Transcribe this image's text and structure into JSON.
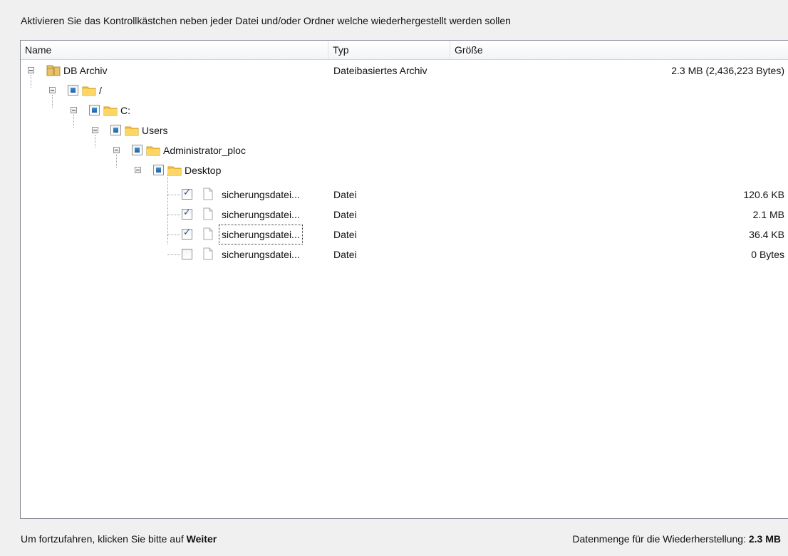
{
  "instruction": "Aktivieren Sie das Kontrollkästchen neben jeder Datei und/oder Ordner welche wiederhergestellt werden sollen",
  "columns": {
    "name": "Name",
    "type": "Typ",
    "size": "Größe"
  },
  "tree": {
    "root": {
      "label": "DB Archiv",
      "type": "Dateibasiertes Archiv",
      "size": "2.3 MB (2,436,223 Bytes)",
      "icon": "archive-folder-icon"
    },
    "folders": [
      {
        "label": "/",
        "state": "partial"
      },
      {
        "label": "C:",
        "state": "partial"
      },
      {
        "label": "Users",
        "state": "partial"
      },
      {
        "label": "Administrator_ploc",
        "state": "partial"
      },
      {
        "label": "Desktop",
        "state": "partial"
      }
    ],
    "files": [
      {
        "label": "sicherungsdatei...",
        "type": "Datei",
        "size": "120.6 KB",
        "checked": true
      },
      {
        "label": "sicherungsdatei...",
        "type": "Datei",
        "size": "2.1 MB",
        "checked": true
      },
      {
        "label": "sicherungsdatei...",
        "type": "Datei",
        "size": "36.4 KB",
        "checked": true,
        "focused": true
      },
      {
        "label": "sicherungsdatei...",
        "type": "Datei",
        "size": "0 Bytes",
        "checked": false
      }
    ]
  },
  "footer": {
    "hint_prefix": "Um fortzufahren, klicken Sie bitte auf",
    "hint_button": "Weiter",
    "amount_label": "Datenmenge für die Wiederherstellung:",
    "amount_value": "2.3 MB"
  },
  "colors": {
    "folder": "#f6c343",
    "checkbox_partial": "#2b6fb8",
    "checkmark": "#2b4c8c"
  }
}
